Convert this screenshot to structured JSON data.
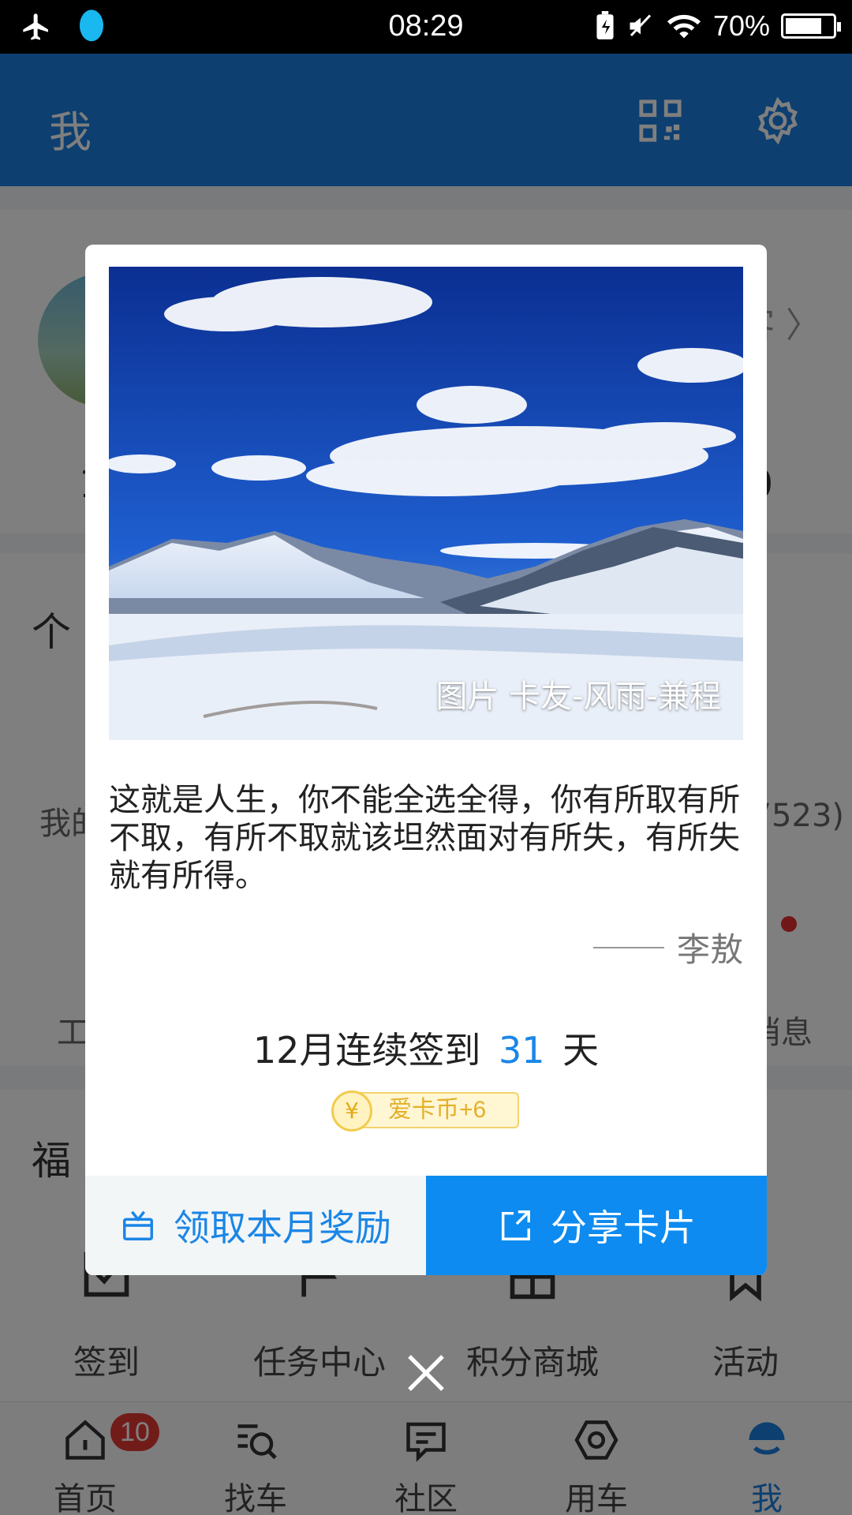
{
  "status_bar": {
    "time": "08:29",
    "battery": "70%"
  },
  "header": {
    "title": "我"
  },
  "background": {
    "visitor_text": "客",
    "stat_left": "1",
    "stat_right": "0",
    "personal_title": "个",
    "row1_left": "我的",
    "row1_right": "7523)",
    "row2_left": "工",
    "row2_right": "消息",
    "welfare_title": "福",
    "welfare_items": [
      {
        "label": "签到",
        "icon": "checkin-icon"
      },
      {
        "label": "任务中心",
        "icon": "flag-icon"
      },
      {
        "label": "积分商城",
        "icon": "gift-icon"
      },
      {
        "label": "活动",
        "icon": "bookmark-icon"
      }
    ]
  },
  "tabs": [
    {
      "label": "首页",
      "icon": "home-icon",
      "badge": "10"
    },
    {
      "label": "找车",
      "icon": "search-car-icon"
    },
    {
      "label": "社区",
      "icon": "chat-icon"
    },
    {
      "label": "用车",
      "icon": "hex-nut-icon"
    },
    {
      "label": "我",
      "icon": "profile-face-icon",
      "active": true
    }
  ],
  "dialog": {
    "photo_credit": "图片 卡友-风雨-兼程",
    "quote": "这就是人生，你不能全选全得，你有所取有所不取，有所不取就该坦然面对有所失，有所失就有所得。",
    "author": "李敖",
    "checkin_prefix": "12月连续签到",
    "checkin_days": "31",
    "checkin_suffix": "天",
    "coin_symbol": "¥",
    "reward_text": "爱卡币+6",
    "claim_button": "领取本月奖励",
    "share_button": "分享卡片"
  },
  "colors": {
    "brand": "#1b7fe0",
    "share_button": "#0d8bf0",
    "badge": "#e53935"
  }
}
